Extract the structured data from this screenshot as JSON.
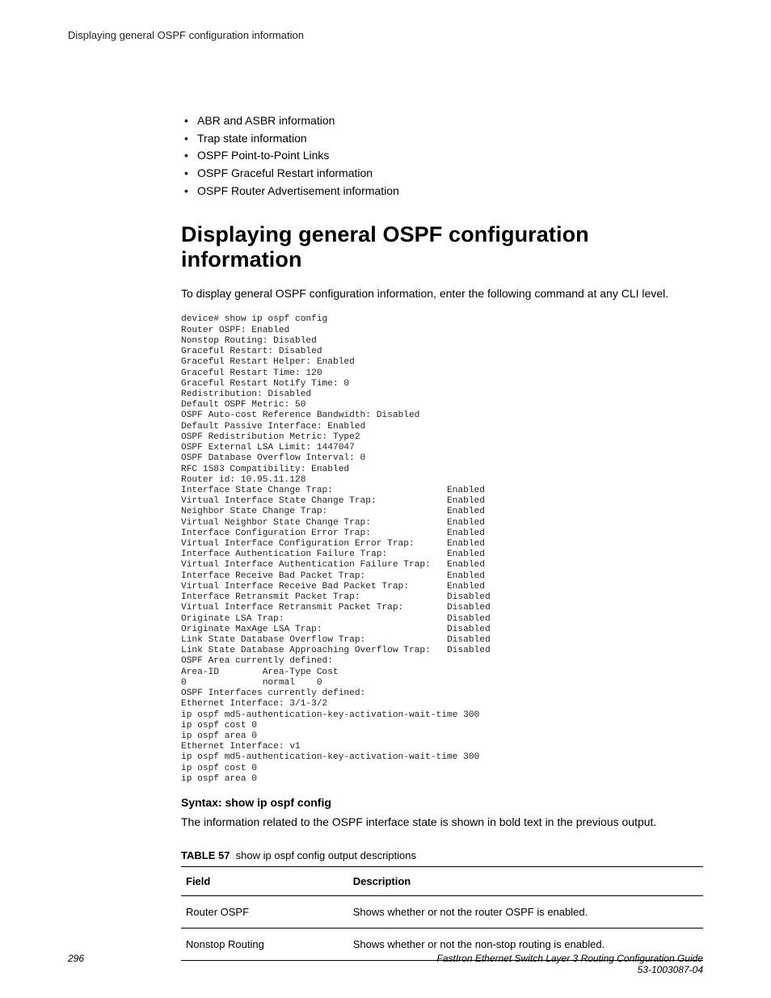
{
  "running_head": "Displaying general OSPF configuration information",
  "bullets": [
    "ABR and ASBR information",
    "Trap state information",
    "OSPF Point-to-Point Links",
    "OSPF Graceful Restart information",
    "OSPF Router Advertisement information"
  ],
  "heading": "Displaying general OSPF configuration information",
  "intro": "To display general OSPF configuration information, enter the following command at any CLI level.",
  "cli": "device# show ip ospf config\nRouter OSPF: Enabled\nNonstop Routing: Disabled\nGraceful Restart: Disabled\nGraceful Restart Helper: Enabled\nGraceful Restart Time: 120\nGraceful Restart Notify Time: 0\nRedistribution: Disabled\nDefault OSPF Metric: 50\nOSPF Auto-cost Reference Bandwidth: Disabled\nDefault Passive Interface: Enabled\nOSPF Redistribution Metric: Type2\nOSPF External LSA Limit: 1447047\nOSPF Database Overflow Interval: 0\nRFC 1583 Compatibility: Enabled\nRouter id: 10.95.11.128\nInterface State Change Trap:                     Enabled\nVirtual Interface State Change Trap:             Enabled\nNeighbor State Change Trap:                      Enabled\nVirtual Neighbor State Change Trap:              Enabled\nInterface Configuration Error Trap:              Enabled\nVirtual Interface Configuration Error Trap:      Enabled\nInterface Authentication Failure Trap:           Enabled\nVirtual Interface Authentication Failure Trap:   Enabled\nInterface Receive Bad Packet Trap:               Enabled\nVirtual Interface Receive Bad Packet Trap:       Enabled\nInterface Retransmit Packet Trap:                Disabled\nVirtual Interface Retransmit Packet Trap:        Disabled\nOriginate LSA Trap:                              Disabled\nOriginate MaxAge LSA Trap:                       Disabled\nLink State Database Overflow Trap:               Disabled\nLink State Database Approaching Overflow Trap:   Disabled\nOSPF Area currently defined:\nArea-ID        Area-Type Cost\n0              normal    0\nOSPF Interfaces currently defined:\nEthernet Interface: 3/1-3/2\nip ospf md5-authentication-key-activation-wait-time 300\nip ospf cost 0\nip ospf area 0\nEthernet Interface: v1\nip ospf md5-authentication-key-activation-wait-time 300\nip ospf cost 0\nip ospf area 0",
  "syntax": "Syntax: show ip ospf config",
  "after_cli": "The information related to the OSPF interface state is shown in bold text in the previous output.",
  "table": {
    "label": "TABLE 57",
    "caption": "show ip ospf config output descriptions",
    "head": {
      "c1": "Field",
      "c2": "Description"
    },
    "rows": [
      {
        "c1": "Router OSPF",
        "c2": "Shows whether or not the router OSPF is enabled."
      },
      {
        "c1": "Nonstop Routing",
        "c2": "Shows whether or not the non-stop routing is enabled."
      }
    ]
  },
  "footer": {
    "page": "296",
    "title": "FastIron Ethernet Switch Layer 3 Routing Configuration Guide",
    "docnum": "53-1003087-04"
  }
}
